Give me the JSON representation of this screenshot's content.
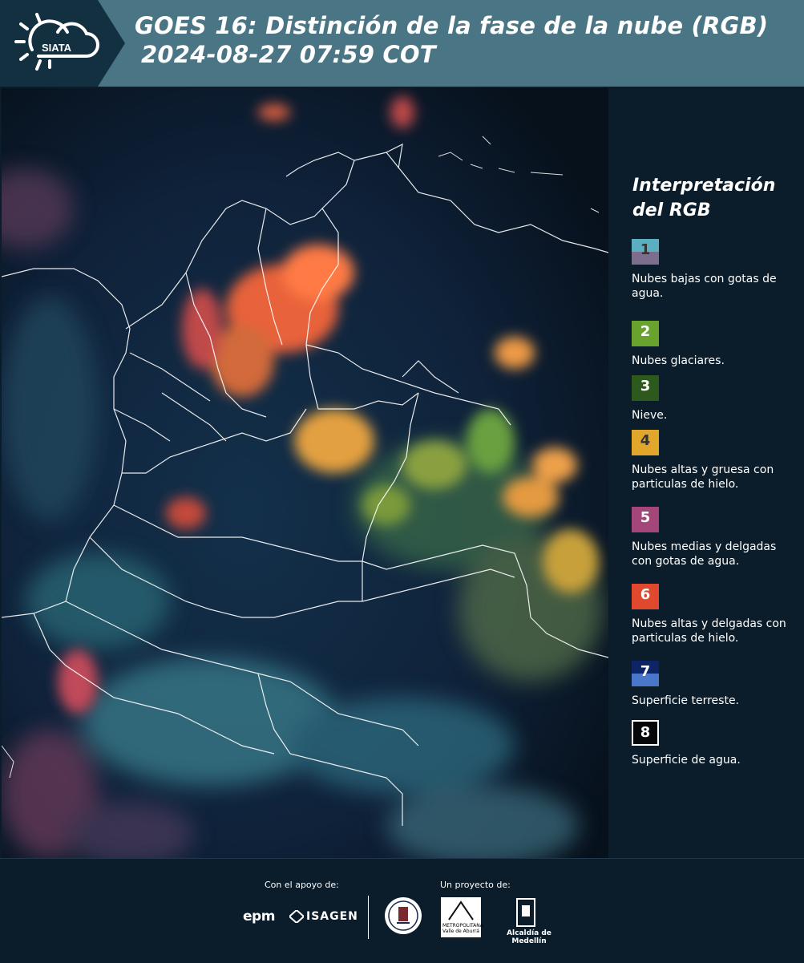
{
  "header": {
    "logo_text": "SIATA",
    "title_line1": "GOES 16: Distinción de la fase de la nube (RGB)",
    "title_line2": "2024-08-27 07:59 COT",
    "background": "#4a7585"
  },
  "map": {
    "icon": "satellite-rgb-map"
  },
  "legend": {
    "title_line1": "Interpretación",
    "title_line2": "del RGB",
    "items": [
      {
        "number": "1",
        "label": "Nubes bajas con gotas de agua.",
        "color_top": "#5ab0c0",
        "color_bottom": "#7d6e8e"
      },
      {
        "number": "2",
        "label": "Nubes glaciares.",
        "color_top": "#6aa22e",
        "color_bottom": "#6aa22e"
      },
      {
        "number": "3",
        "label": "Nieve.",
        "color_top": "#2d5a1c",
        "color_bottom": "#2d5a1c"
      },
      {
        "number": "4",
        "label": "Nubes altas y gruesa con particulas de hielo.",
        "color_top": "#e1a72a",
        "color_bottom": "#e1a72a"
      },
      {
        "number": "5",
        "label": "Nubes medias y delgadas con gotas de agua.",
        "color_top": "#a5467b",
        "color_bottom": "#a5467b"
      },
      {
        "number": "6",
        "label": "Nubes altas y delgadas con particulas de hielo.",
        "color_top": "#e0492e",
        "color_bottom": "#e0492e"
      },
      {
        "number": "7",
        "label": "Superficie terreste.",
        "color_top": "#0d2566",
        "color_bottom": "#4a77c9"
      },
      {
        "number": "8",
        "label": "Superficie de agua.",
        "color_top": "#04080a",
        "color_bottom": "#04080a"
      }
    ]
  },
  "footer": {
    "support_label": "Con el apoyo de:",
    "project_label": "Un proyecto de:",
    "epm": "epm",
    "isagen": "ISAGEN",
    "area_line1": "METROPOLITANA",
    "area_line2": "Valle de Aburrá",
    "alcaldia": "Alcaldía de Medellín"
  }
}
